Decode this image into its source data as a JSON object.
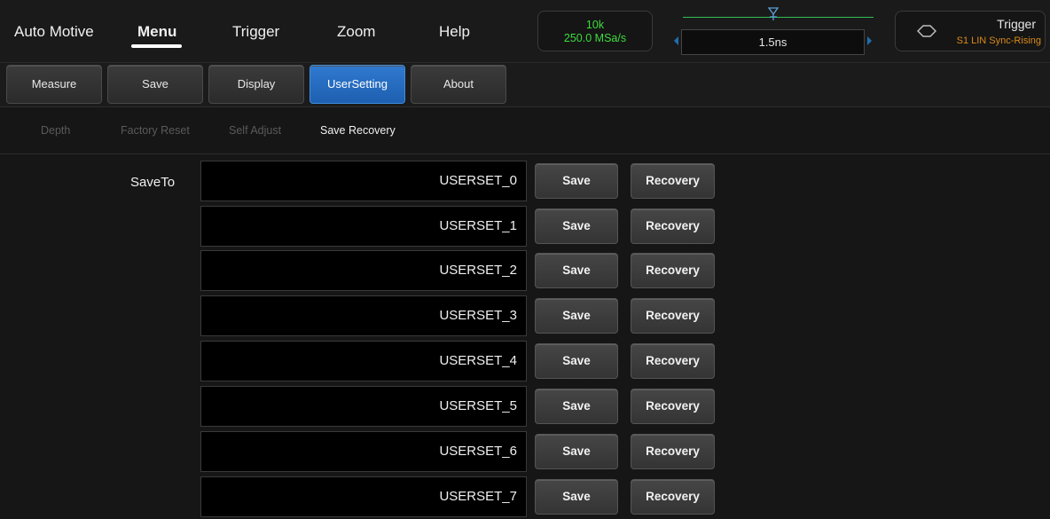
{
  "nav": {
    "items": [
      {
        "label": "Auto Motive"
      },
      {
        "label": "Menu",
        "active": true
      },
      {
        "label": "Trigger"
      },
      {
        "label": "Zoom"
      },
      {
        "label": "Help"
      }
    ]
  },
  "acquisition": {
    "depth": "10k",
    "sample_rate": "250.0 MSa/s"
  },
  "timebase": {
    "value": "1.5ns"
  },
  "trigger": {
    "title": "Trigger",
    "source": "S1 LIN Sync-Rising"
  },
  "tabs": [
    {
      "label": "Measure"
    },
    {
      "label": "Save"
    },
    {
      "label": "Display"
    },
    {
      "label": "UserSetting",
      "active": true
    },
    {
      "label": "About"
    }
  ],
  "subtabs": [
    {
      "label": "Depth"
    },
    {
      "label": "Factory Reset"
    },
    {
      "label": "Self Adjust"
    },
    {
      "label": "Save Recovery",
      "active": true
    }
  ],
  "content": {
    "saveto_label": "SaveTo",
    "slots": [
      {
        "name": "USERSET_0",
        "save_label": "Save",
        "recovery_label": "Recovery"
      },
      {
        "name": "USERSET_1",
        "save_label": "Save",
        "recovery_label": "Recovery"
      },
      {
        "name": "USERSET_2",
        "save_label": "Save",
        "recovery_label": "Recovery"
      },
      {
        "name": "USERSET_3",
        "save_label": "Save",
        "recovery_label": "Recovery"
      },
      {
        "name": "USERSET_4",
        "save_label": "Save",
        "recovery_label": "Recovery"
      },
      {
        "name": "USERSET_5",
        "save_label": "Save",
        "recovery_label": "Recovery"
      },
      {
        "name": "USERSET_6",
        "save_label": "Save",
        "recovery_label": "Recovery"
      },
      {
        "name": "USERSET_7",
        "save_label": "Save",
        "recovery_label": "Recovery"
      }
    ]
  },
  "colors": {
    "accent_blue": "#1e5fb0",
    "sample_green": "#3ddc3d",
    "trigger_orange": "#d98a1a"
  }
}
